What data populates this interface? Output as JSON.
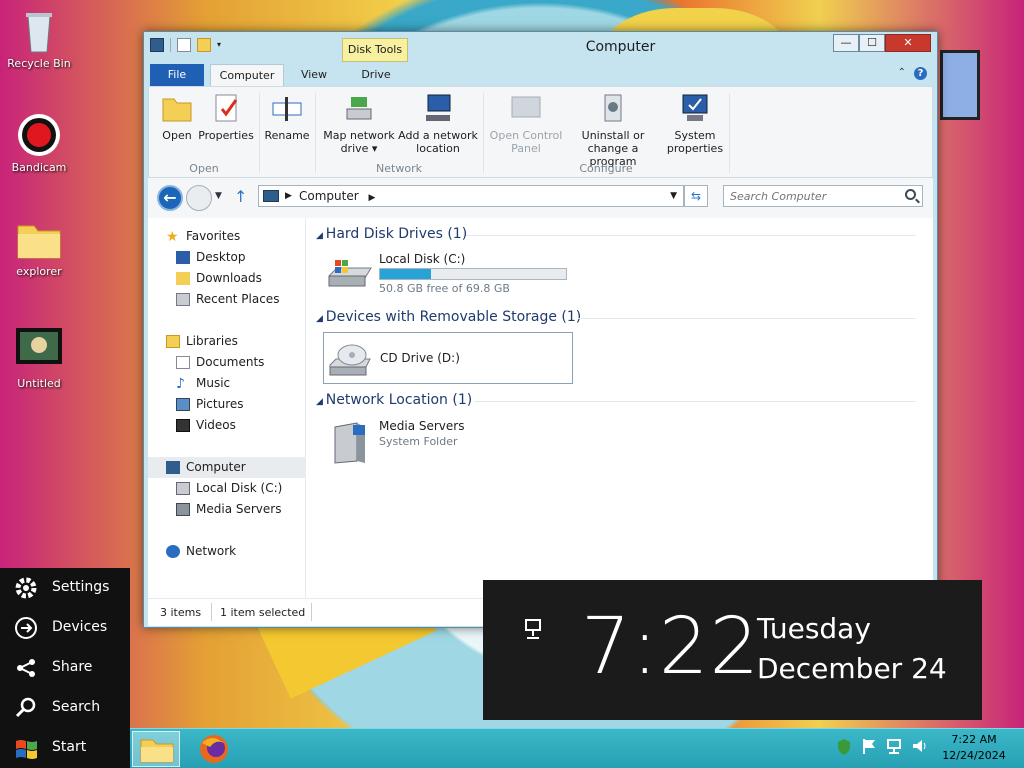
{
  "desktop": {
    "icons": [
      {
        "label": "Recycle Bin"
      },
      {
        "label": "Bandicam"
      },
      {
        "label": "explorer"
      },
      {
        "label": "Untitled"
      }
    ]
  },
  "window": {
    "title": "Computer",
    "context_tab": "Disk Tools",
    "tabs": {
      "file": "File",
      "computer": "Computer",
      "view": "View",
      "drive": "Drive"
    },
    "controls": {
      "minimize": "—",
      "maximize": "☐",
      "close": "✕"
    },
    "ribbon": {
      "open": "Open",
      "properties": "Properties",
      "rename": "Rename",
      "map_network_drive": [
        "Map network",
        "drive ▾"
      ],
      "add_network_location": [
        "Add a network",
        "location"
      ],
      "open_control_panel": [
        "Open Control",
        "Panel"
      ],
      "uninstall": [
        "Uninstall or",
        "change a program"
      ],
      "system_properties": [
        "System",
        "properties"
      ],
      "groups": {
        "open": "Open",
        "network": "Network",
        "configure": "Configure"
      }
    },
    "address": {
      "segment": "Computer",
      "search_placeholder": "Search Computer"
    },
    "nav": {
      "favorites": "Favorites",
      "desktop": "Desktop",
      "downloads": "Downloads",
      "recent_places": "Recent Places",
      "libraries": "Libraries",
      "documents": "Documents",
      "music": "Music",
      "pictures": "Pictures",
      "videos": "Videos",
      "computer": "Computer",
      "local_disk": "Local Disk (C:)",
      "media_servers": "Media Servers",
      "network": "Network"
    },
    "groups": {
      "hdd": "Hard Disk Drives (1)",
      "removable": "Devices with Removable Storage (1)",
      "network": "Network Location (1)"
    },
    "items": {
      "local_disk": {
        "name": "Local Disk (C:)",
        "free": "50.8 GB free of 69.8 GB",
        "used_fraction": 0.272
      },
      "cd_drive": {
        "name": "CD Drive (D:)"
      },
      "media_servers": {
        "name": "Media Servers",
        "sub": "System Folder"
      }
    },
    "status": {
      "count": "3 items",
      "selected": "1 item selected"
    }
  },
  "charms": {
    "settings": "Settings",
    "devices": "Devices",
    "share": "Share",
    "search": "Search",
    "start": "Start"
  },
  "clock_overlay": {
    "time": "7:22",
    "day": "Tuesday",
    "date": "December 24"
  },
  "taskbar": {
    "time": "7:22 AM",
    "date": "12/24/2024"
  }
}
